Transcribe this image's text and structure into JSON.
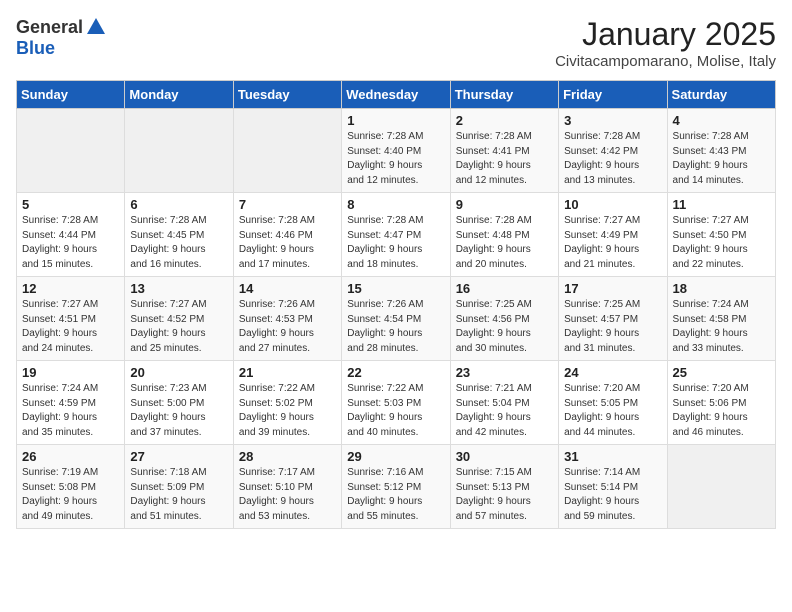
{
  "logo": {
    "general": "General",
    "blue": "Blue"
  },
  "title": "January 2025",
  "subtitle": "Civitacampomarano, Molise, Italy",
  "weekdays": [
    "Sunday",
    "Monday",
    "Tuesday",
    "Wednesday",
    "Thursday",
    "Friday",
    "Saturday"
  ],
  "weeks": [
    [
      {
        "day": "",
        "info": ""
      },
      {
        "day": "",
        "info": ""
      },
      {
        "day": "",
        "info": ""
      },
      {
        "day": "1",
        "info": "Sunrise: 7:28 AM\nSunset: 4:40 PM\nDaylight: 9 hours\nand 12 minutes."
      },
      {
        "day": "2",
        "info": "Sunrise: 7:28 AM\nSunset: 4:41 PM\nDaylight: 9 hours\nand 12 minutes."
      },
      {
        "day": "3",
        "info": "Sunrise: 7:28 AM\nSunset: 4:42 PM\nDaylight: 9 hours\nand 13 minutes."
      },
      {
        "day": "4",
        "info": "Sunrise: 7:28 AM\nSunset: 4:43 PM\nDaylight: 9 hours\nand 14 minutes."
      }
    ],
    [
      {
        "day": "5",
        "info": "Sunrise: 7:28 AM\nSunset: 4:44 PM\nDaylight: 9 hours\nand 15 minutes."
      },
      {
        "day": "6",
        "info": "Sunrise: 7:28 AM\nSunset: 4:45 PM\nDaylight: 9 hours\nand 16 minutes."
      },
      {
        "day": "7",
        "info": "Sunrise: 7:28 AM\nSunset: 4:46 PM\nDaylight: 9 hours\nand 17 minutes."
      },
      {
        "day": "8",
        "info": "Sunrise: 7:28 AM\nSunset: 4:47 PM\nDaylight: 9 hours\nand 18 minutes."
      },
      {
        "day": "9",
        "info": "Sunrise: 7:28 AM\nSunset: 4:48 PM\nDaylight: 9 hours\nand 20 minutes."
      },
      {
        "day": "10",
        "info": "Sunrise: 7:27 AM\nSunset: 4:49 PM\nDaylight: 9 hours\nand 21 minutes."
      },
      {
        "day": "11",
        "info": "Sunrise: 7:27 AM\nSunset: 4:50 PM\nDaylight: 9 hours\nand 22 minutes."
      }
    ],
    [
      {
        "day": "12",
        "info": "Sunrise: 7:27 AM\nSunset: 4:51 PM\nDaylight: 9 hours\nand 24 minutes."
      },
      {
        "day": "13",
        "info": "Sunrise: 7:27 AM\nSunset: 4:52 PM\nDaylight: 9 hours\nand 25 minutes."
      },
      {
        "day": "14",
        "info": "Sunrise: 7:26 AM\nSunset: 4:53 PM\nDaylight: 9 hours\nand 27 minutes."
      },
      {
        "day": "15",
        "info": "Sunrise: 7:26 AM\nSunset: 4:54 PM\nDaylight: 9 hours\nand 28 minutes."
      },
      {
        "day": "16",
        "info": "Sunrise: 7:25 AM\nSunset: 4:56 PM\nDaylight: 9 hours\nand 30 minutes."
      },
      {
        "day": "17",
        "info": "Sunrise: 7:25 AM\nSunset: 4:57 PM\nDaylight: 9 hours\nand 31 minutes."
      },
      {
        "day": "18",
        "info": "Sunrise: 7:24 AM\nSunset: 4:58 PM\nDaylight: 9 hours\nand 33 minutes."
      }
    ],
    [
      {
        "day": "19",
        "info": "Sunrise: 7:24 AM\nSunset: 4:59 PM\nDaylight: 9 hours\nand 35 minutes."
      },
      {
        "day": "20",
        "info": "Sunrise: 7:23 AM\nSunset: 5:00 PM\nDaylight: 9 hours\nand 37 minutes."
      },
      {
        "day": "21",
        "info": "Sunrise: 7:22 AM\nSunset: 5:02 PM\nDaylight: 9 hours\nand 39 minutes."
      },
      {
        "day": "22",
        "info": "Sunrise: 7:22 AM\nSunset: 5:03 PM\nDaylight: 9 hours\nand 40 minutes."
      },
      {
        "day": "23",
        "info": "Sunrise: 7:21 AM\nSunset: 5:04 PM\nDaylight: 9 hours\nand 42 minutes."
      },
      {
        "day": "24",
        "info": "Sunrise: 7:20 AM\nSunset: 5:05 PM\nDaylight: 9 hours\nand 44 minutes."
      },
      {
        "day": "25",
        "info": "Sunrise: 7:20 AM\nSunset: 5:06 PM\nDaylight: 9 hours\nand 46 minutes."
      }
    ],
    [
      {
        "day": "26",
        "info": "Sunrise: 7:19 AM\nSunset: 5:08 PM\nDaylight: 9 hours\nand 49 minutes."
      },
      {
        "day": "27",
        "info": "Sunrise: 7:18 AM\nSunset: 5:09 PM\nDaylight: 9 hours\nand 51 minutes."
      },
      {
        "day": "28",
        "info": "Sunrise: 7:17 AM\nSunset: 5:10 PM\nDaylight: 9 hours\nand 53 minutes."
      },
      {
        "day": "29",
        "info": "Sunrise: 7:16 AM\nSunset: 5:12 PM\nDaylight: 9 hours\nand 55 minutes."
      },
      {
        "day": "30",
        "info": "Sunrise: 7:15 AM\nSunset: 5:13 PM\nDaylight: 9 hours\nand 57 minutes."
      },
      {
        "day": "31",
        "info": "Sunrise: 7:14 AM\nSunset: 5:14 PM\nDaylight: 9 hours\nand 59 minutes."
      },
      {
        "day": "",
        "info": ""
      }
    ]
  ]
}
